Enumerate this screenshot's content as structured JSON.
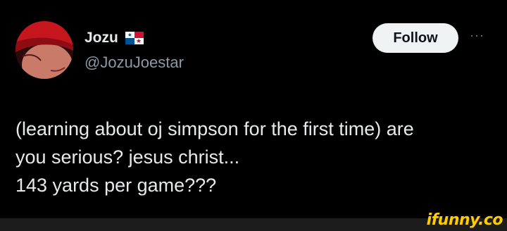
{
  "author": {
    "display_name": "Jozu",
    "handle": "@JozuJoestar",
    "flag_icon": "panama-flag-icon",
    "avatar_icon": "anime-avatar-icon"
  },
  "follow_button": {
    "label": "Follow"
  },
  "more_menu": {
    "label": "···"
  },
  "tweet": {
    "lines": [
      "(learning about oj simpson for the first time) are",
      "you serious? jesus christ...",
      "143 yards per game???"
    ]
  },
  "watermark": {
    "text": "ifunny.co"
  },
  "colors": {
    "background": "#000000",
    "text": "#e7e9ea",
    "muted": "#8b98a5",
    "follow_bg": "#eff3f4",
    "watermark": "#ffcc00"
  }
}
